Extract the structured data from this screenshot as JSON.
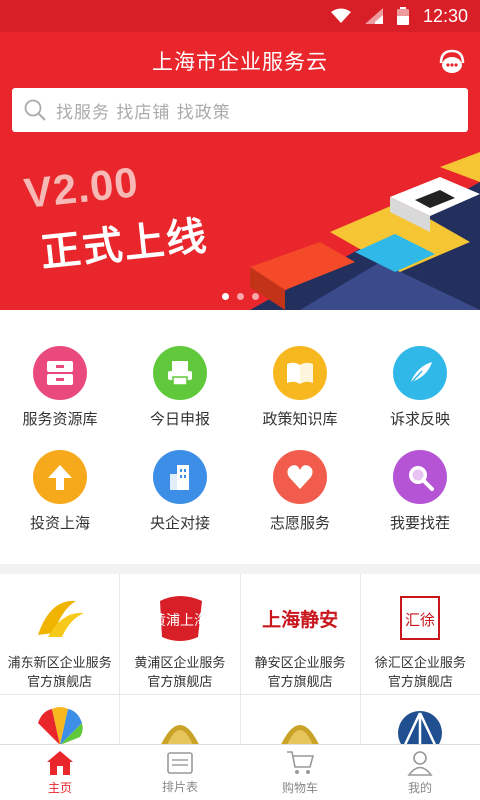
{
  "status": {
    "time": "12:30",
    "icons": [
      "wifi-icon",
      "signal-icon",
      "battery-icon"
    ]
  },
  "header": {
    "title": "上海市企业服务云",
    "service_icon": "customer-service-icon"
  },
  "search": {
    "placeholder": "找服务 找店铺 找政策"
  },
  "banner": {
    "version": "V2.00",
    "headline": "正式上线",
    "slides": 3,
    "active_slide": 1
  },
  "services": [
    {
      "label": "服务资源库",
      "icon": "resource-library-icon",
      "color": "#ea4a7b"
    },
    {
      "label": "今日申报",
      "icon": "printer-icon",
      "color": "#5fc93b"
    },
    {
      "label": "政策知识库",
      "icon": "book-icon",
      "color": "#f7b81f"
    },
    {
      "label": "诉求反映",
      "icon": "feather-icon",
      "color": "#2fb8e8"
    },
    {
      "label": "投资上海",
      "icon": "arrow-up-icon",
      "color": "#f7a91c"
    },
    {
      "label": "央企对接",
      "icon": "building-icon",
      "color": "#3c8ee6"
    },
    {
      "label": "志愿服务",
      "icon": "heart-icon",
      "color": "#f25c4d"
    },
    {
      "label": "我要找茬",
      "icon": "magnifier-icon",
      "color": "#b654d6"
    }
  ],
  "stores": [
    {
      "name": "浦东新区企业服务",
      "sub": "官方旗舰店",
      "logo": "pudong-logo"
    },
    {
      "name": "黄浦区企业服务",
      "sub": "官方旗舰店",
      "logo": "huangpu-logo",
      "logo_text": "黄浦上海"
    },
    {
      "name": "静安区企业服务",
      "sub": "官方旗舰店",
      "logo": "jingan-logo",
      "logo_text": "上海静安"
    },
    {
      "name": "徐汇区企业服务",
      "sub": "官方旗舰店",
      "logo": "xuhui-logo",
      "logo_text": "汇徐"
    }
  ],
  "stores_row2_logos": [
    "colorful-fan-logo",
    "gold-badge-logo",
    "gold-badge-logo",
    "blue-bridge-logo"
  ],
  "tabs": [
    {
      "label": "主页",
      "icon": "home-icon",
      "active": true
    },
    {
      "label": "排片表",
      "icon": "schedule-icon",
      "active": false
    },
    {
      "label": "购物车",
      "icon": "cart-icon",
      "active": false
    },
    {
      "label": "我的",
      "icon": "profile-icon",
      "active": false
    }
  ],
  "colors": {
    "brand": "#e8262c",
    "statusbar": "#d81e26"
  }
}
